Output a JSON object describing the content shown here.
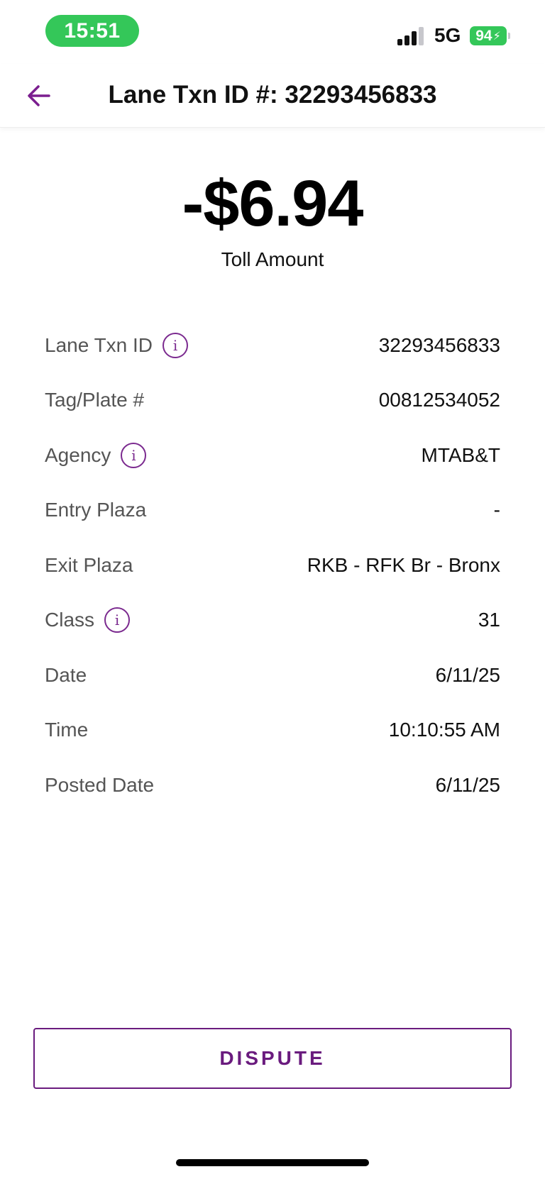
{
  "status_bar": {
    "time": "15:51",
    "network": "5G",
    "battery": "94"
  },
  "header": {
    "title": "Lane Txn ID #: 32293456833"
  },
  "amount": {
    "value": "-$6.94",
    "label": "Toll Amount"
  },
  "details": [
    {
      "label": "Lane Txn ID",
      "value": "32293456833",
      "info": true
    },
    {
      "label": "Tag/Plate #",
      "value": "00812534052",
      "info": false
    },
    {
      "label": "Agency",
      "value": "MTAB&T",
      "info": true
    },
    {
      "label": "Entry Plaza",
      "value": "-",
      "info": false
    },
    {
      "label": "Exit Plaza",
      "value": "RKB - RFK Br - Bronx",
      "info": false
    },
    {
      "label": "Class",
      "value": "31",
      "info": true
    },
    {
      "label": "Date",
      "value": "6/11/25",
      "info": false
    },
    {
      "label": "Time",
      "value": "10:10:55 AM",
      "info": false
    },
    {
      "label": "Posted Date",
      "value": "6/11/25",
      "info": false
    }
  ],
  "dispute": {
    "label": "DISPUTE"
  },
  "colors": {
    "accent": "#6a1b7e",
    "status_green": "#34c759"
  },
  "icons": {
    "back": "arrow-left-icon",
    "info": "info-circle-icon"
  }
}
